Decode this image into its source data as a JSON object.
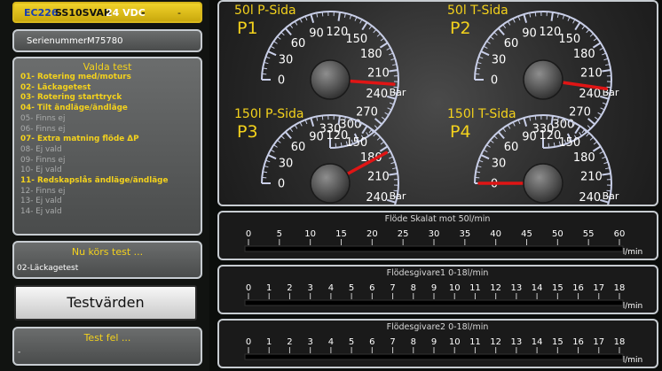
{
  "header": {
    "model": "EC226",
    "serial_code": "SS10SVAB",
    "voltage": "24 VDC",
    "extra": "-"
  },
  "serial": {
    "label": "Serienummer:",
    "value": "M75780"
  },
  "tests": {
    "title": "Valda test",
    "items": [
      {
        "label": "01- Rotering med/moturs",
        "active": true
      },
      {
        "label": "02- Läckagetest",
        "active": true
      },
      {
        "label": "03- Rotering starttryck",
        "active": true
      },
      {
        "label": "04- Tilt ändläge/ändläge",
        "active": true
      },
      {
        "label": "05- Finns ej",
        "active": false
      },
      {
        "label": "06- Finns ej",
        "active": false
      },
      {
        "label": "07- Extra matning flöde ΔP",
        "active": true
      },
      {
        "label": "08- Ej vald",
        "active": false
      },
      {
        "label": "09- Finns ej",
        "active": false
      },
      {
        "label": "10- Ej vald",
        "active": false
      },
      {
        "label": "11- Redskapslås ändläge/ändläge",
        "active": true
      },
      {
        "label": "12- Finns ej",
        "active": false
      },
      {
        "label": "13- Ej vald",
        "active": false
      },
      {
        "label": "14- Ej vald",
        "active": false
      }
    ]
  },
  "running": {
    "title": "Nu körs test ...",
    "value": "02-Läckagetest"
  },
  "button_label": "Testvärden",
  "errors": {
    "title": "Test fel ...",
    "value": "-"
  },
  "gauges": [
    {
      "name": "P1",
      "title": "50l P-Sida",
      "unit": "Bar",
      "value": 225
    },
    {
      "name": "P2",
      "title": "50l T-Sida",
      "unit": "Bar",
      "value": 230
    },
    {
      "name": "P3",
      "title": "150l P-Sida",
      "unit": "Bar",
      "value": 185
    },
    {
      "name": "P4",
      "title": "150l T-Sida",
      "unit": "Bar",
      "value": 0
    }
  ],
  "gauge_ticks": [
    "0",
    "30",
    "60",
    "90",
    "120",
    "150",
    "180",
    "210",
    "240",
    "270",
    "300",
    "330"
  ],
  "flows": [
    {
      "title": "Flöde  Skalat mot 50l/min",
      "unit": "l/min",
      "ticks": [
        "0",
        "5",
        "10",
        "15",
        "20",
        "25",
        "30",
        "35",
        "40",
        "45",
        "50",
        "55",
        "60"
      ],
      "value": 0
    },
    {
      "title": "Flödesgivare1  0-18l/min",
      "unit": "l/min",
      "ticks": [
        "0",
        "1",
        "2",
        "3",
        "4",
        "5",
        "6",
        "7",
        "8",
        "9",
        "10",
        "11",
        "12",
        "13",
        "14",
        "15",
        "16",
        "17",
        "18"
      ],
      "value": 0
    },
    {
      "title": "Flödesgivare2  0-18l/min",
      "unit": "l/min",
      "ticks": [
        "0",
        "1",
        "2",
        "3",
        "4",
        "5",
        "6",
        "7",
        "8",
        "9",
        "10",
        "11",
        "12",
        "13",
        "14",
        "15",
        "16",
        "17",
        "18"
      ],
      "value": 0
    }
  ],
  "colors": {
    "accent": "#f4d21c",
    "needle": "#e01515"
  }
}
